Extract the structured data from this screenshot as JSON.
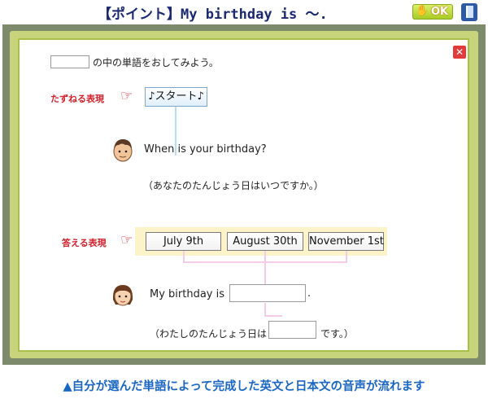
{
  "header": {
    "title": "【ポイント】My birthday is 〜.",
    "ok_label": "OK"
  },
  "instruction": {
    "text": "の中の単語をおしてみよう。"
  },
  "ask": {
    "label": "たずねる表現",
    "start_button": "♪スタート♪",
    "question": "When is your birthday?",
    "question_ja": "（あなたのたんじょう日はいつですか。）"
  },
  "answer": {
    "label": "答える表現",
    "choices": [
      "July 9th",
      "August 30th",
      "November 1st"
    ],
    "sentence_prefix": "My birthday is",
    "sentence_suffix": ".",
    "ja_prefix": "（わたしのたんじょう日は",
    "ja_suffix": "です。）"
  },
  "caption": "▲自分が選んだ単語によって完成した英文と日本文の音声が流れます",
  "colors": {
    "title": "#1b2a70",
    "label_red": "#d3202a",
    "caption_blue": "#1a66c4",
    "frame_green": "#c7d47b",
    "connector_pink": "#f5cbe7",
    "connector_blue": "#b8dcf3"
  },
  "icons": {
    "ok": "hand-ok-icon",
    "exit": "door-exit-icon",
    "close": "close-x-icon",
    "pointer": "pointing-hand-icon"
  }
}
